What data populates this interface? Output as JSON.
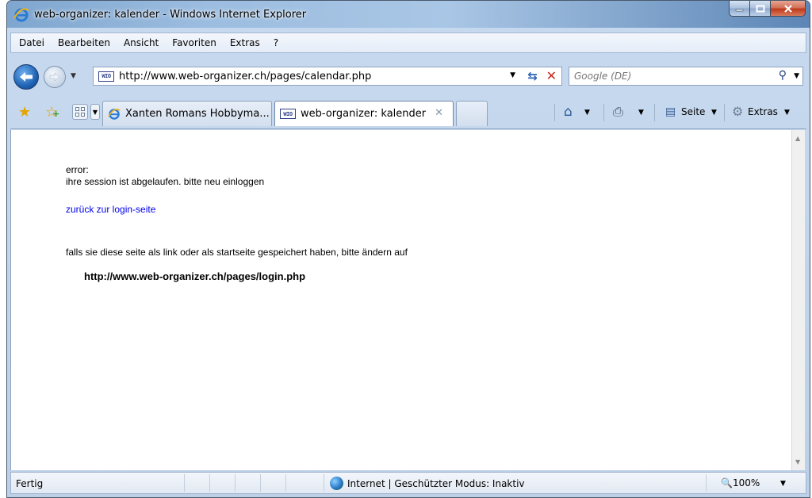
{
  "window": {
    "title": "web-organizer: kalender - Windows Internet Explorer"
  },
  "menu": [
    "Datei",
    "Bearbeiten",
    "Ansicht",
    "Favoriten",
    "Extras",
    "?"
  ],
  "address": {
    "url": "http://www.web-organizer.ch/pages/calendar.php",
    "site_badge": "WIO"
  },
  "search": {
    "placeholder": "Google (DE)"
  },
  "tabs": [
    {
      "label": "Xanten Romans Hobbyma...",
      "active": false
    },
    {
      "label": "web-organizer: kalender",
      "active": true
    }
  ],
  "commands": {
    "page_label": "Seite",
    "tools_label": "Extras"
  },
  "page": {
    "error_label": "error:",
    "error_message": "ihre session ist abgelaufen. bitte neu einloggen",
    "back_link": "zurück zur login-seite",
    "note": "falls sie diese seite als link oder als startseite gespeichert haben, bitte ändern auf",
    "login_url": "http://www.web-organizer.ch/pages/login.php"
  },
  "status": {
    "text": "Fertig",
    "zone": "Internet | Geschützter Modus: Inaktiv",
    "zoom": "100%"
  }
}
